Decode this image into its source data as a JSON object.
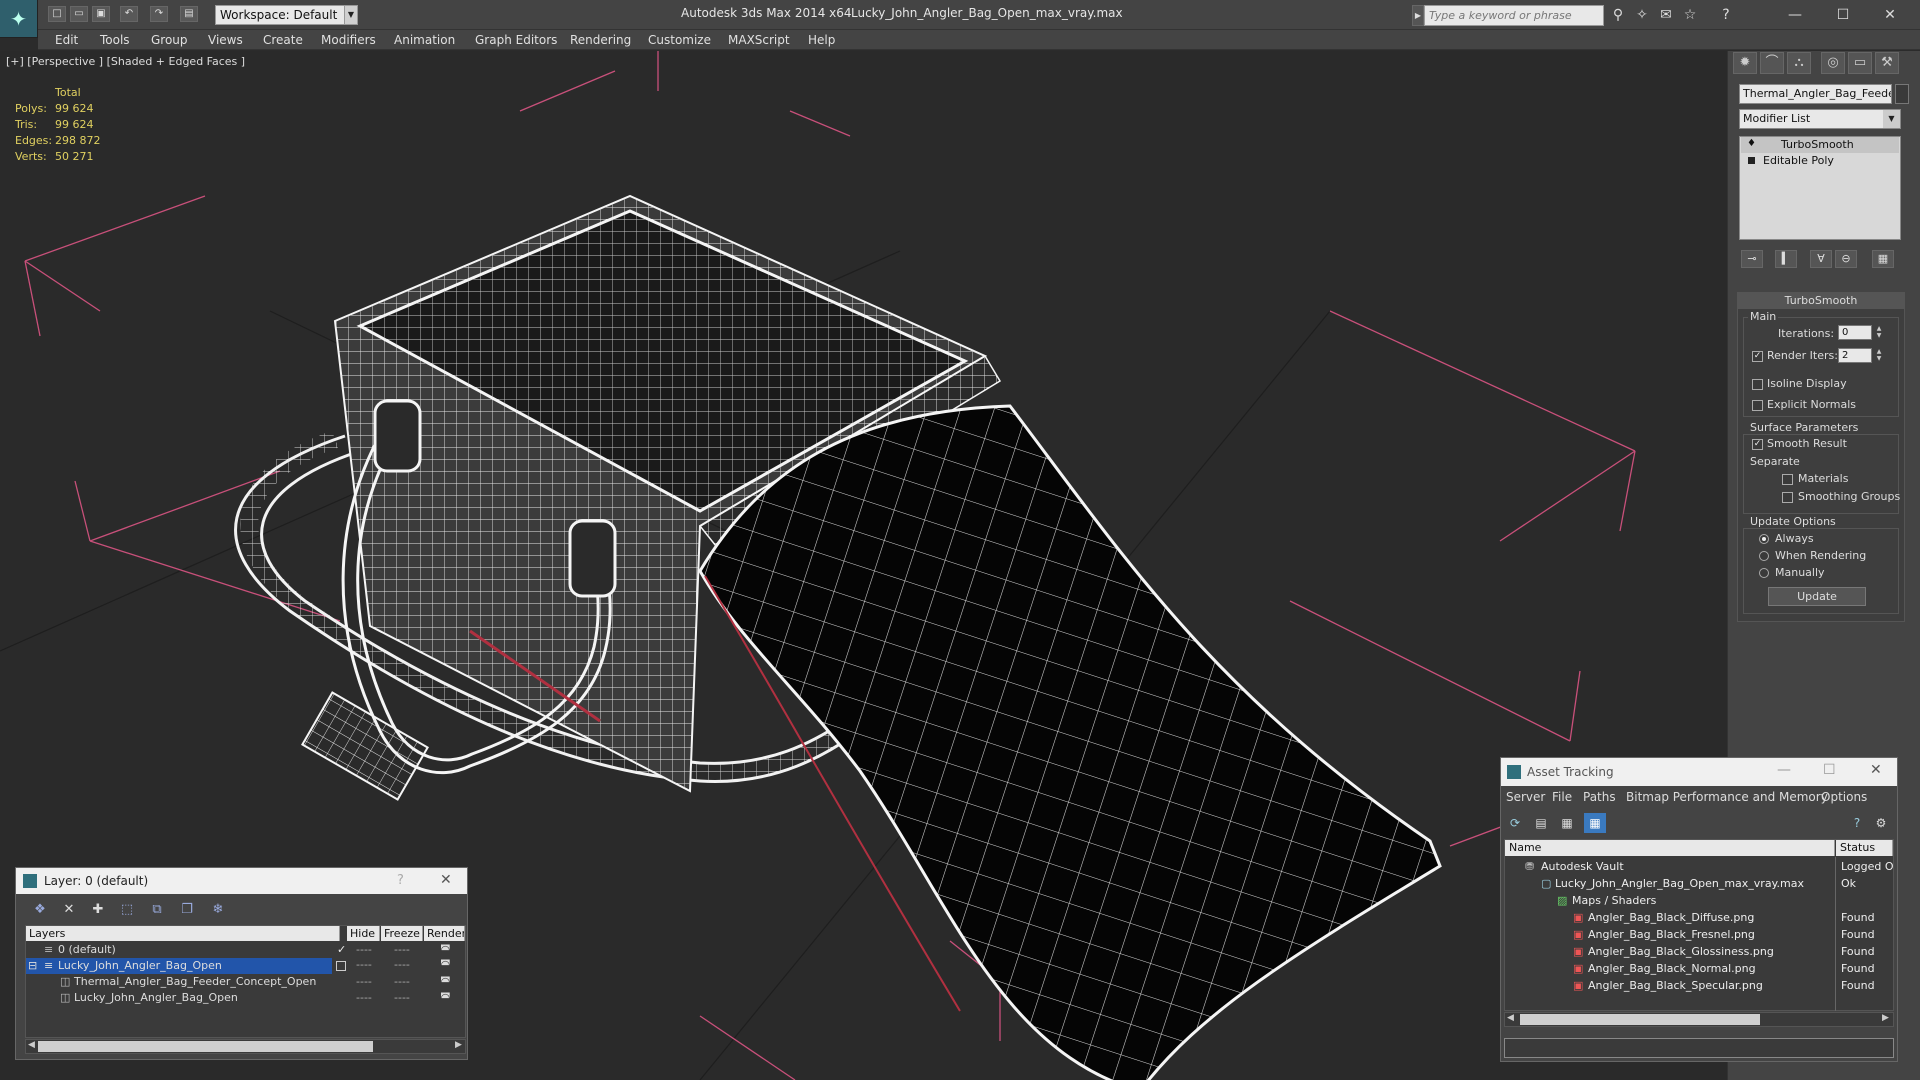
{
  "titlebar": {
    "app": "Autodesk 3ds Max  2014 x64",
    "file": "Lucky_John_Angler_Bag_Open_max_vray.max",
    "workspace": "Workspace: Default",
    "search_placeholder": "Type a keyword or phrase"
  },
  "menu": [
    "Edit",
    "Tools",
    "Group",
    "Views",
    "Create",
    "Modifiers",
    "Animation",
    "Graph Editors",
    "Rendering",
    "Customize",
    "MAXScript",
    "Help"
  ],
  "viewport": {
    "label": "[+] [Perspective ] [Shaded + Edged Faces ]",
    "stats": {
      "header": "Total",
      "labels": [
        "Polys:",
        "Tris:",
        "Edges:",
        "Verts:"
      ],
      "values": [
        "99 624",
        "99 624",
        "298 872",
        "50 271"
      ]
    }
  },
  "command_panel": {
    "object_name": "Thermal_Angler_Bag_Feeder_Concept_Open",
    "modifier_list": "Modifier List",
    "stack": [
      "TurboSmooth",
      "Editable Poly"
    ],
    "rollout": {
      "title": "TurboSmooth",
      "main": "Main",
      "iterations_label": "Iterations:",
      "iterations": "0",
      "render_iters_label": "Render Iters:",
      "render_iters": "2",
      "isoline": "Isoline Display",
      "explicit": "Explicit Normals",
      "surface": "Surface Parameters",
      "smooth_result": "Smooth Result",
      "separate": "Separate",
      "materials": "Materials",
      "smoothing_groups": "Smoothing Groups",
      "update_options": "Update Options",
      "always": "Always",
      "when_rendering": "When Rendering",
      "manually": "Manually",
      "update": "Update"
    }
  },
  "layer_dialog": {
    "title": "Layer: 0 (default)",
    "help": "?",
    "columns": [
      "Layers",
      "Hide",
      "Freeze",
      "Render"
    ],
    "rows": [
      {
        "name": "0 (default)",
        "dash": "----"
      },
      {
        "name": "Lucky_John_Angler_Bag_Open",
        "dash": "----"
      },
      {
        "name": "Thermal_Angler_Bag_Feeder_Concept_Open",
        "dash": "----"
      },
      {
        "name": "Lucky_John_Angler_Bag_Open",
        "dash": "----"
      }
    ]
  },
  "asset_dialog": {
    "title": "Asset Tracking",
    "menu": [
      "Server",
      "File",
      "Paths",
      "Bitmap Performance and Memory",
      "Options"
    ],
    "columns": [
      "Name",
      "Status"
    ],
    "rows": [
      {
        "name": "Autodesk Vault",
        "status": "Logged O"
      },
      {
        "name": "Lucky_John_Angler_Bag_Open_max_vray.max",
        "status": "Ok"
      },
      {
        "name": "Maps / Shaders",
        "status": ""
      },
      {
        "name": "Angler_Bag_Black_Diffuse.png",
        "status": "Found"
      },
      {
        "name": "Angler_Bag_Black_Fresnel.png",
        "status": "Found"
      },
      {
        "name": "Angler_Bag_Black_Glossiness.png",
        "status": "Found"
      },
      {
        "name": "Angler_Bag_Black_Normal.png",
        "status": "Found"
      },
      {
        "name": "Angler_Bag_Black_Specular.png",
        "status": "Found"
      }
    ]
  },
  "colors": {
    "selection": "#2255aa",
    "stats": "#e0d060",
    "grid_pink": "#c8507a"
  }
}
